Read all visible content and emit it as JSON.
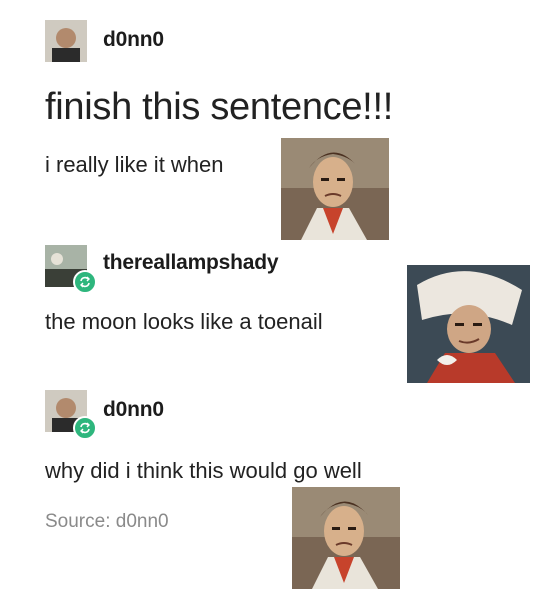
{
  "posts": [
    {
      "username": "d0nn0",
      "title": "finish this sentence!!!",
      "text": "i really like it when"
    },
    {
      "username": "thereallampshady",
      "text": "the moon looks like a toenail"
    },
    {
      "username": "d0nn0",
      "text": "why did i think this would go well"
    }
  ],
  "source": {
    "label": "Source: d0nn0"
  },
  "colors": {
    "reblog_badge": "#2eb67d",
    "source_text": "#8a8a8a"
  }
}
